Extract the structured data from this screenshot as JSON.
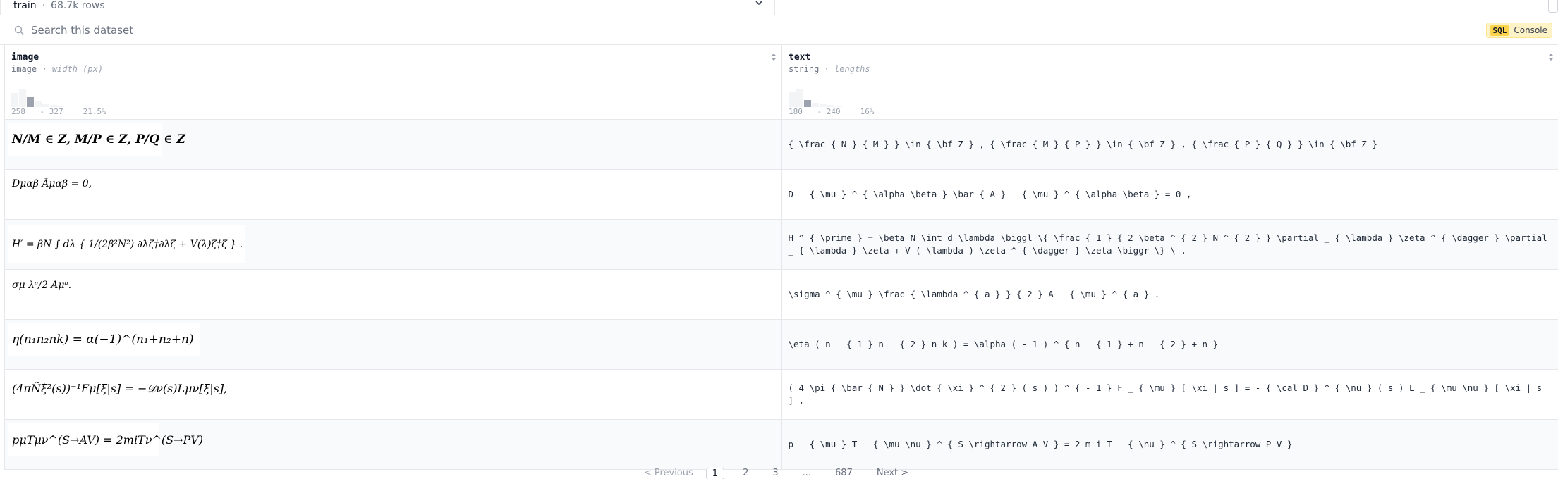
{
  "split": {
    "name": "train",
    "rows": "68.7k rows"
  },
  "search": {
    "placeholder": "Search this dataset"
  },
  "sql": {
    "badge": "SQL",
    "label": "Console"
  },
  "columns": [
    {
      "name": "image",
      "type": "image",
      "stat": "width (px)",
      "hist_min": "258",
      "hist_max": "327",
      "hist_pct": "21.5%"
    },
    {
      "name": "text",
      "type": "string",
      "stat": "lengths",
      "hist_min": "180",
      "hist_max": "240",
      "hist_pct": "16%"
    }
  ],
  "rows": [
    {
      "image_formula": "N/M ∈ Z, M/P ∈ Z, P/Q ∈ Z",
      "text": "{ \\frac { N } { M } } \\in { \\bf Z } , { \\frac { M } { P } } \\in { \\bf Z } , { \\frac { P } { Q } } \\in { \\bf Z }"
    },
    {
      "image_formula": "Dμαβ Āμαβ = 0,",
      "text": "D _ { \\mu } ^ { \\alpha \\beta } \\bar { A } _ { \\mu } ^ { \\alpha \\beta } = 0 ,"
    },
    {
      "image_formula": "H′ = βN ∫ dλ { 1/(2β²N²) ∂λζ†∂λζ + V(λ)ζ†ζ } .",
      "text": "H ^ { \\prime } = \\beta N \\int d \\lambda \\biggl \\{ \\frac { 1 } { 2 \\beta ^ { 2 } N ^ { 2 } } \\partial _ { \\lambda } \\zeta ^ { \\dagger } \\partial _ { \\lambda } \\zeta + V ( \\lambda ) \\zeta ^ { \\dagger } \\zeta \\biggr \\} \\ ."
    },
    {
      "image_formula": "σμ λᵃ/2 Aμᵃ.",
      "text": "\\sigma ^ { \\mu } \\frac { \\lambda ^ { a } } { 2 } A _ { \\mu } ^ { a } ."
    },
    {
      "image_formula": "η(n₁n₂nk) = α(−1)^(n₁+n₂+n)",
      "text": "\\eta ( n _ { 1 } n _ { 2 } n k ) = \\alpha ( - 1 ) ^ { n _ { 1 } + n _ { 2 } + n }"
    },
    {
      "image_formula": "(4πÑξ̇²(s))⁻¹Fμ[ξ|s] = −𝒟ν(s)Lμν[ξ|s],",
      "text": "( 4 \\pi { \\bar { N } } \\dot { \\xi } ^ { 2 } ( s ) ) ^ { - 1 } F _ { \\mu } [ \\xi | s ] = - { \\cal D } ^ { \\nu } ( s ) L _ { \\mu \\nu } [ \\xi | s ] ,"
    },
    {
      "image_formula": "pμTμν^(S→AV) = 2miTν^(S→PV)",
      "text": "p _ { \\mu } T _ { \\mu \\nu } ^ { S \\rightarrow A V } = 2 m i T _ { \\nu } ^ { S \\rightarrow P V }"
    }
  ],
  "pager": {
    "prev": "< Previous",
    "pages": [
      "1",
      "2",
      "3",
      "...",
      "687"
    ],
    "next": "Next >"
  }
}
